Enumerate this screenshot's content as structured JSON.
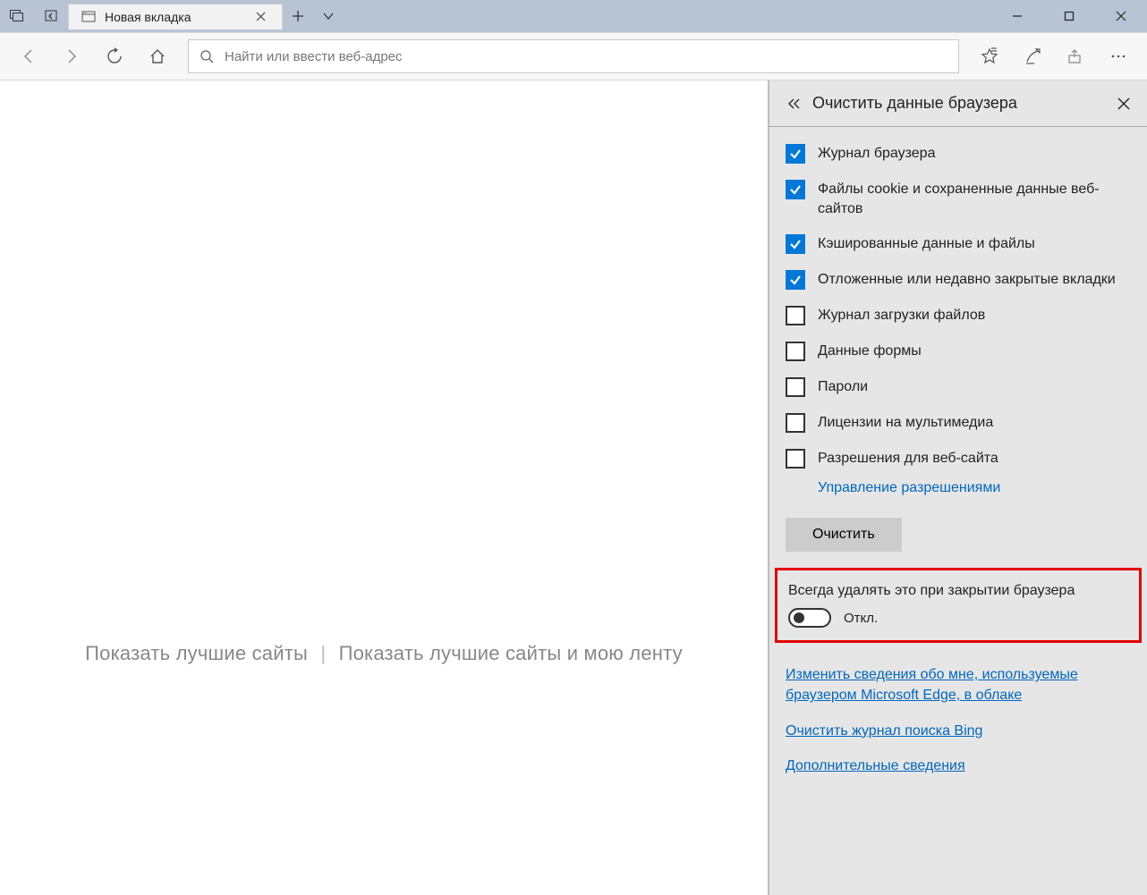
{
  "tab": {
    "title": "Новая вкладка"
  },
  "url": {
    "placeholder": "Найти или ввести веб-адрес"
  },
  "newtab": {
    "top_sites": "Показать лучшие сайты",
    "feed": "Показать лучшие сайты и мою ленту"
  },
  "panel": {
    "title": "Очистить данные браузера",
    "options": [
      {
        "label": "Журнал браузера",
        "checked": true
      },
      {
        "label": "Файлы cookie и сохраненные данные веб-сайтов",
        "checked": true
      },
      {
        "label": "Кэшированные данные и файлы",
        "checked": true
      },
      {
        "label": "Отложенные или недавно закрытые вкладки",
        "checked": true
      },
      {
        "label": "Журнал загрузки файлов",
        "checked": false
      },
      {
        "label": "Данные формы",
        "checked": false
      },
      {
        "label": "Пароли",
        "checked": false
      },
      {
        "label": "Лицензии на мультимедиа",
        "checked": false
      },
      {
        "label": "Разрешения для веб-сайта",
        "checked": false
      }
    ],
    "manage_permissions": "Управление разрешениями",
    "clear_button": "Очистить",
    "always_clear_label": "Всегда удалять это при закрытии браузера",
    "toggle_state": "Откл.",
    "links": {
      "change_cloud": "Изменить сведения обо мне, используемые браузером Microsoft Edge, в облаке",
      "clear_bing": "Очистить журнал поиска Bing",
      "more_info": "Дополнительные сведения"
    }
  }
}
